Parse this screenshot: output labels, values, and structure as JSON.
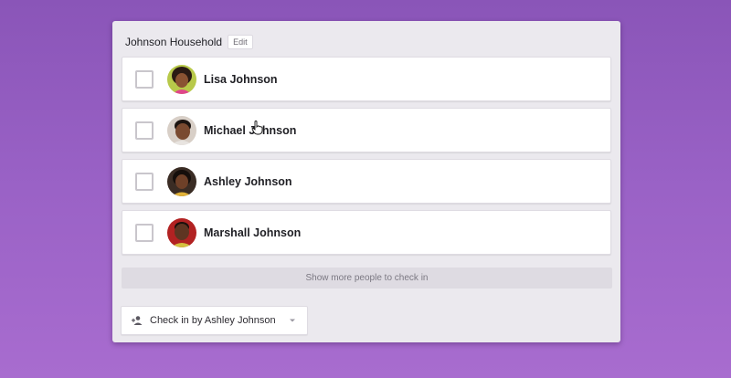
{
  "household": {
    "title": "Johnson Household",
    "edit_label": "Edit"
  },
  "people": [
    {
      "name": "Lisa Johnson"
    },
    {
      "name": "Michael Johnson"
    },
    {
      "name": "Ashley Johnson"
    },
    {
      "name": "Marshall Johnson"
    }
  ],
  "show_more_label": "Show more people to check in",
  "checkin": {
    "label": "Check in by Ashley Johnson"
  },
  "colors": {
    "background": "#9a62c6",
    "card": "#ebe9ee",
    "accent": "#1f1f24"
  }
}
